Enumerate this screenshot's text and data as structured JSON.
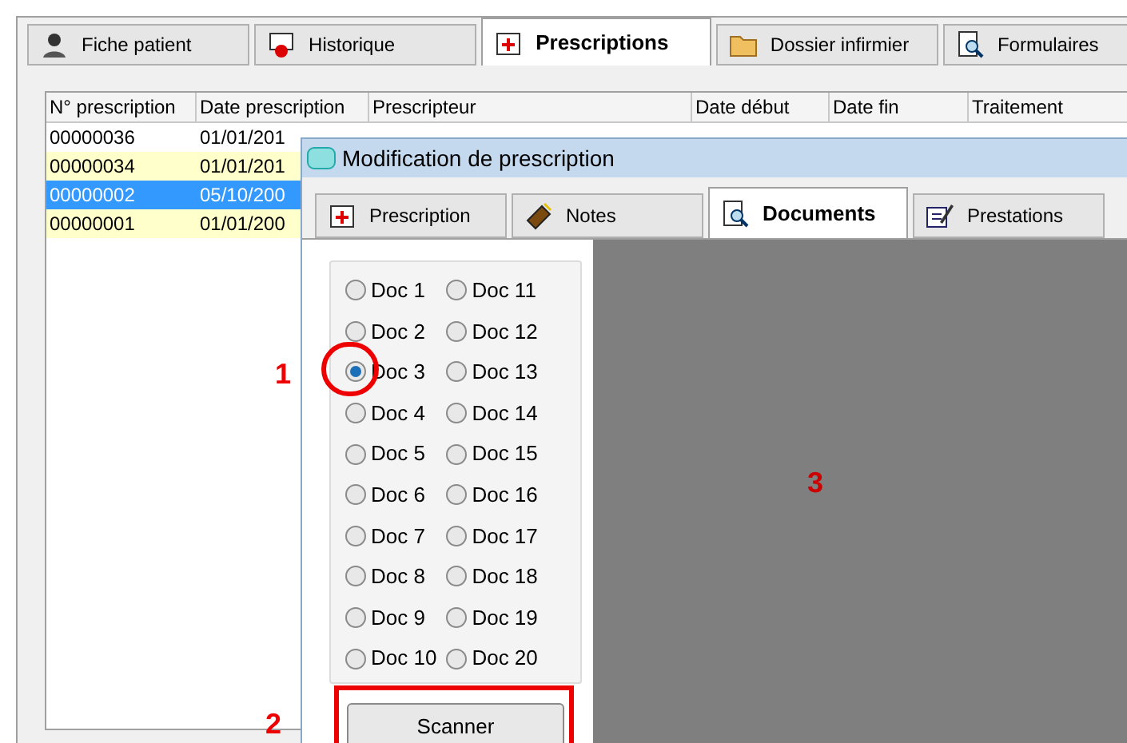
{
  "main_tabs": [
    {
      "label": "Fiche patient",
      "selected": false
    },
    {
      "label": "Historique",
      "selected": false
    },
    {
      "label": "Prescriptions",
      "selected": true
    },
    {
      "label": "Dossier infirmier",
      "selected": false
    },
    {
      "label": "Formulaires",
      "selected": false
    }
  ],
  "table": {
    "columns": [
      "N° prescription",
      "Date prescription",
      "Prescripteur",
      "Date début",
      "Date fin",
      "Traitement"
    ],
    "rows": [
      {
        "cells": [
          "00000036",
          "01/01/201"
        ],
        "highlighted": false,
        "selected": false
      },
      {
        "cells": [
          "00000034",
          "01/01/201"
        ],
        "highlighted": true,
        "selected": false
      },
      {
        "cells": [
          "00000002",
          "05/10/200"
        ],
        "selected": true
      },
      {
        "cells": [
          "00000001",
          "01/01/200"
        ],
        "highlighted": true,
        "selected": false
      }
    ]
  },
  "dialog": {
    "title": "Modification de prescription",
    "tabs": [
      {
        "label": "Prescription",
        "selected": false
      },
      {
        "label": "Notes",
        "selected": false
      },
      {
        "label": "Documents",
        "selected": true
      },
      {
        "label": "Prestations",
        "selected": false
      }
    ],
    "documents": [
      {
        "label": "Doc 1",
        "selected": false
      },
      {
        "label": "Doc 2",
        "selected": false
      },
      {
        "label": "Doc 3",
        "selected": true
      },
      {
        "label": "Doc 4",
        "selected": false
      },
      {
        "label": "Doc 5",
        "selected": false
      },
      {
        "label": "Doc 6",
        "selected": false
      },
      {
        "label": "Doc 7",
        "selected": false
      },
      {
        "label": "Doc 8",
        "selected": false
      },
      {
        "label": "Doc 9",
        "selected": false
      },
      {
        "label": "Doc 10",
        "selected": false
      },
      {
        "label": "Doc 11",
        "selected": false
      },
      {
        "label": "Doc 12",
        "selected": false
      },
      {
        "label": "Doc 13",
        "selected": false
      },
      {
        "label": "Doc 14",
        "selected": false
      },
      {
        "label": "Doc 15",
        "selected": false
      },
      {
        "label": "Doc 16",
        "selected": false
      },
      {
        "label": "Doc 17",
        "selected": false
      },
      {
        "label": "Doc 18",
        "selected": false
      },
      {
        "label": "Doc 19",
        "selected": false
      },
      {
        "label": "Doc 20",
        "selected": false
      }
    ],
    "scan_button": "Scanner"
  },
  "annotations": [
    {
      "label": "1"
    },
    {
      "label": "2"
    },
    {
      "label": "3"
    }
  ]
}
